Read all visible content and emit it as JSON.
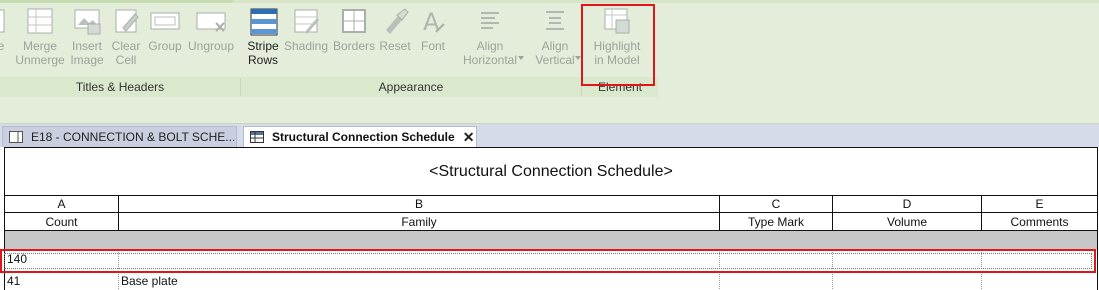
{
  "ribbon": {
    "buttons": [
      {
        "label": "Merge\nUnmerge",
        "icon": "merge-cells-icon"
      },
      {
        "label": "Insert\nImage",
        "icon": "insert-image-icon"
      },
      {
        "label": "Clear\nCell",
        "icon": "clear-cell-icon"
      },
      {
        "label": "Group",
        "icon": "group-icon"
      },
      {
        "label": "Ungroup",
        "icon": "ungroup-icon"
      },
      {
        "label": "Stripe\nRows",
        "icon": "stripe-rows-icon"
      },
      {
        "label": "Shading",
        "icon": "shading-icon"
      },
      {
        "label": "Borders",
        "icon": "borders-icon"
      },
      {
        "label": "Reset",
        "icon": "reset-brush-icon"
      },
      {
        "label": "Font",
        "icon": "font-icon"
      },
      {
        "label": "Align\nHorizontal",
        "icon": "align-horizontal-icon"
      },
      {
        "label": "Align\nVertical",
        "icon": "align-vertical-icon"
      },
      {
        "label": "Highlight\nin Model",
        "icon": "highlight-in-model-icon"
      }
    ],
    "panels": {
      "titles_headers": "Titles & Headers",
      "appearance": "Appearance",
      "element": "Element"
    }
  },
  "tabs": [
    {
      "label": "E18 - CONNECTION & BOLT SCHE...",
      "icon": "sheet-icon"
    },
    {
      "label": "Structural Connection Schedule",
      "icon": "schedule-icon",
      "close": "✕"
    }
  ],
  "schedule": {
    "title": "<Structural Connection Schedule>",
    "column_letters": [
      "A",
      "B",
      "C",
      "D",
      "E"
    ],
    "column_names": [
      "Count",
      "Family",
      "Type Mark",
      "Volume",
      "Comments"
    ],
    "rows": [
      [
        "140",
        "",
        "",
        "",
        ""
      ],
      [
        "41",
        "Base plate",
        "",
        "",
        ""
      ]
    ]
  },
  "colors": {
    "highlight_red": "#e0161b",
    "ribbon_green": "#e3edda"
  }
}
